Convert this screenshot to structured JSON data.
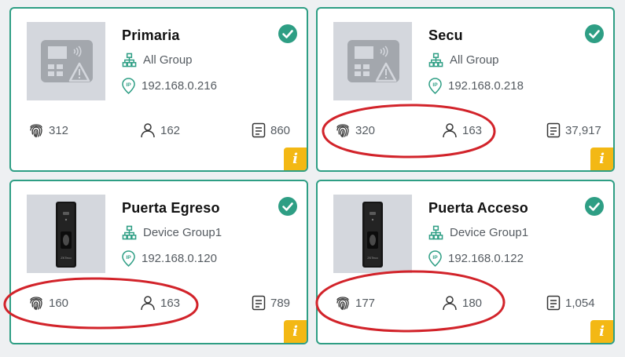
{
  "colors": {
    "border": "#2e9e84",
    "check": "#2e9e84",
    "info_badge": "#f3b814",
    "annotation": "#d2232a"
  },
  "devices": [
    {
      "name": "Primaria",
      "group": "All Group",
      "ip": "192.168.0.216",
      "fingerprints": "312",
      "users": "162",
      "records": "860",
      "image": "generic-terminal-warning-icon",
      "status": "check-icon",
      "info": "i"
    },
    {
      "name": "Secu",
      "group": "All Group",
      "ip": "192.168.0.218",
      "fingerprints": "320",
      "users": "163",
      "records": "37,917",
      "image": "generic-terminal-warning-icon",
      "status": "check-icon",
      "info": "i"
    },
    {
      "name": "Puerta Egreso",
      "group": "Device Group1",
      "ip": "192.168.0.120",
      "fingerprints": "160",
      "users": "163",
      "records": "789",
      "image": "access-reader-photo",
      "status": "check-icon",
      "info": "i"
    },
    {
      "name": "Puerta Acceso",
      "group": "Device Group1",
      "ip": "192.168.0.122",
      "fingerprints": "177",
      "users": "180",
      "records": "1,054",
      "image": "access-reader-photo",
      "status": "check-icon",
      "info": "i"
    }
  ]
}
